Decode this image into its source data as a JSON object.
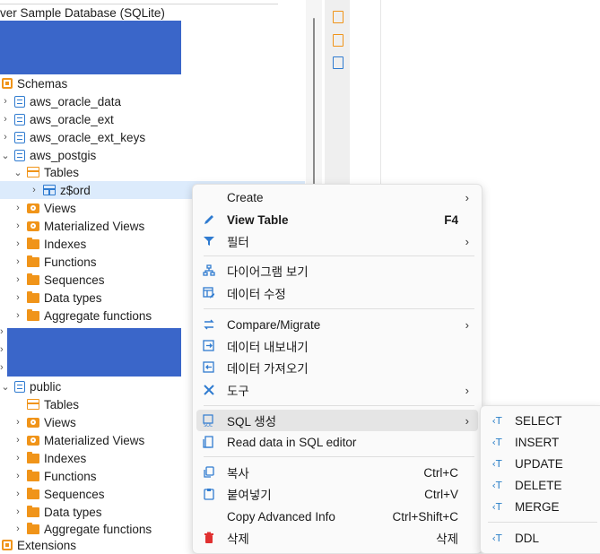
{
  "tree": {
    "connection_label": "ver Sample Database (SQLite)",
    "schemas_label": "Schemas",
    "items": [
      {
        "label": "aws_oracle_data"
      },
      {
        "label": "aws_oracle_ext"
      },
      {
        "label": "aws_oracle_ext_keys"
      },
      {
        "label": "aws_postgis"
      }
    ],
    "aws_postgis_children": {
      "tables": "Tables",
      "table_selected": "z$ord",
      "views": "Views",
      "materialized_views": "Materialized Views",
      "indexes": "Indexes",
      "functions": "Functions",
      "sequences": "Sequences",
      "data_types": "Data types",
      "aggregate_functions": "Aggregate functions"
    },
    "public": {
      "label": "public",
      "tables": "Tables",
      "views": "Views",
      "materialized_views": "Materialized Views",
      "indexes": "Indexes",
      "functions": "Functions",
      "sequences": "Sequences",
      "data_types": "Data types",
      "aggregate_functions": "Aggregate functions"
    },
    "extensions": "Extensions"
  },
  "context_menu": {
    "create": "Create",
    "view_table": "View Table",
    "view_table_shortcut": "F4",
    "filter": "필터",
    "diagram": "다이어그램 보기",
    "edit_data": "데이터 수정",
    "compare_migrate": "Compare/Migrate",
    "export_data": "데이터 내보내기",
    "import_data": "데이터 가져오기",
    "tools": "도구",
    "sql_generate": "SQL 생성",
    "read_sql_editor": "Read data in SQL editor",
    "copy": "복사",
    "copy_shortcut": "Ctrl+C",
    "paste": "붙여넣기",
    "paste_shortcut": "Ctrl+V",
    "copy_advanced": "Copy Advanced Info",
    "copy_advanced_shortcut": "Ctrl+Shift+C",
    "delete": "삭제",
    "delete_shortcut": "삭제"
  },
  "submenu": {
    "select": "SELECT",
    "insert": "INSERT",
    "update": "UPDATE",
    "delete": "DELETE",
    "merge": "MERGE",
    "ddl": "DDL"
  },
  "colors": {
    "accent": "#2f7bd0",
    "folder": "#f09419",
    "highlight_block": "#3a66c9",
    "delete_icon": "#e03030"
  }
}
